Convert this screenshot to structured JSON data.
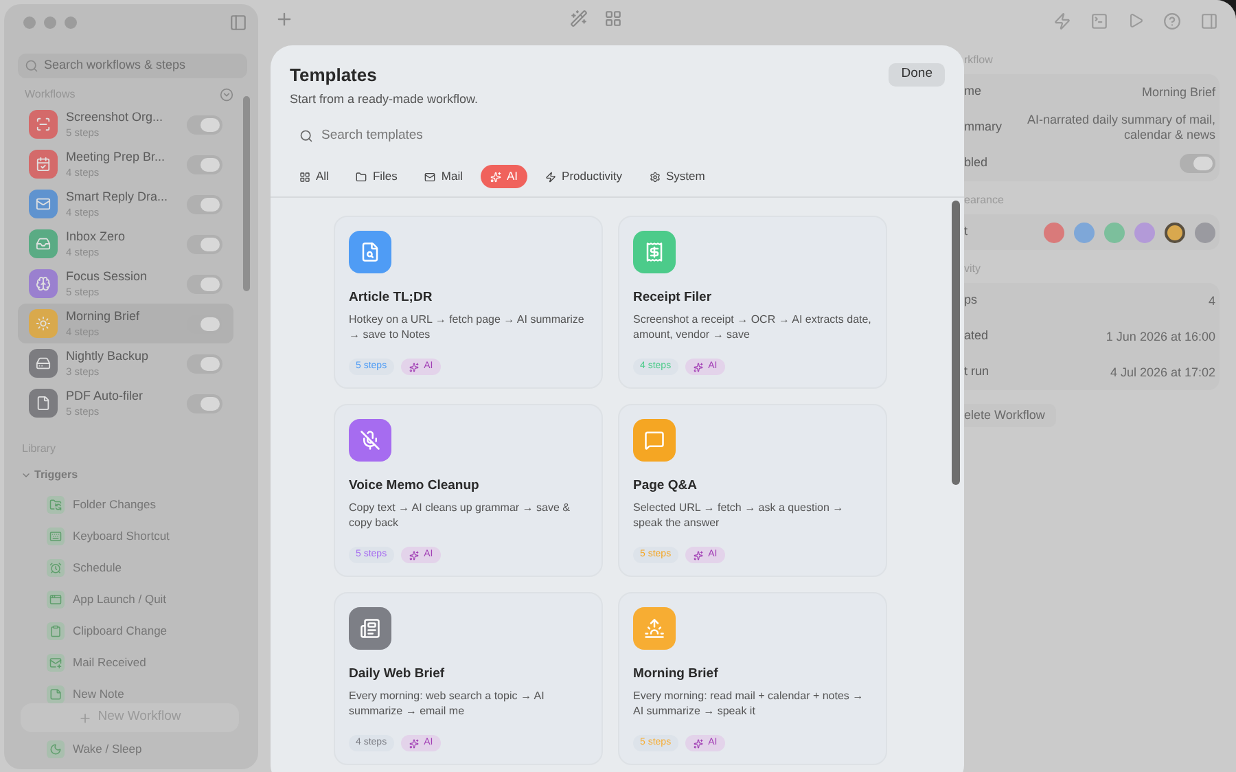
{
  "sidebar": {
    "search": {
      "placeholder": "Search workflows & steps"
    },
    "workflows_label": "Workflows",
    "workflows": [
      {
        "name": "Screenshot Org...",
        "steps": "5 steps",
        "color": "#d46a6a",
        "selected": false,
        "on": true
      },
      {
        "name": "Meeting Prep Br...",
        "steps": "4 steps",
        "color": "#d46a6a",
        "selected": false,
        "on": true
      },
      {
        "name": "Smart Reply Dra...",
        "steps": "4 steps",
        "color": "#5f93cf",
        "selected": false,
        "on": true
      },
      {
        "name": "Inbox Zero",
        "steps": "4 steps",
        "color": "#5aab84",
        "selected": false,
        "on": true
      },
      {
        "name": "Focus Session",
        "steps": "5 steps",
        "color": "#9a80cf",
        "selected": false,
        "on": true
      },
      {
        "name": "Morning Brief",
        "steps": "4 steps",
        "color": "#d9a94c",
        "selected": true,
        "on": true
      },
      {
        "name": "Nightly Backup",
        "steps": "3 steps",
        "color": "#7c7c80",
        "selected": false,
        "on": true
      },
      {
        "name": "PDF Auto-filer",
        "steps": "5 steps",
        "color": "#7c7c80",
        "selected": false,
        "on": true
      }
    ],
    "library_label": "Library",
    "triggers": {
      "label": "Triggers",
      "expanded": true,
      "items": [
        {
          "label": "Folder Changes"
        },
        {
          "label": "Keyboard Shortcut"
        },
        {
          "label": "Schedule"
        },
        {
          "label": "App Launch / Quit"
        },
        {
          "label": "Clipboard Change"
        },
        {
          "label": "Mail Received"
        },
        {
          "label": "New Note"
        },
        {
          "label": "Wake / Sleep"
        }
      ]
    },
    "new_workflow_button": "New Workflow"
  },
  "inspector": {
    "sections": [
      {
        "label": "rkflow",
        "rows": [
          {
            "kind": "text",
            "label": "me",
            "value": "Morning Brief"
          },
          {
            "kind": "text",
            "label": "mmary",
            "value": "AI-narrated daily summary of mail, calendar & news"
          },
          {
            "kind": "toggle",
            "label": "bled",
            "on": true
          }
        ]
      },
      {
        "label": "earance",
        "rows": [
          {
            "kind": "colors",
            "label": "t",
            "colors": [
              {
                "color": "#d97a7a",
                "selected": false
              },
              {
                "color": "#7ea7d8",
                "selected": false
              },
              {
                "color": "#7cbf9c",
                "selected": false
              },
              {
                "color": "#b39ad8",
                "selected": false
              },
              {
                "color": "#d9a84e",
                "selected": true
              },
              {
                "color": "#9a9aa0",
                "selected": false
              }
            ]
          }
        ]
      },
      {
        "label": "vity",
        "rows": [
          {
            "kind": "text",
            "label": "ps",
            "value": "4"
          },
          {
            "kind": "text",
            "label": "ated",
            "value": "1 Jun 2026 at 16:00"
          },
          {
            "kind": "text",
            "label": "t run",
            "value": "4 Jul 2026 at 17:02"
          }
        ]
      }
    ],
    "delete_button": "elete Workflow"
  },
  "modal": {
    "title": "Templates",
    "subtitle": "Start from a ready-made workflow.",
    "done_button": "Done",
    "search": {
      "placeholder": "Search templates"
    },
    "tabs": [
      {
        "label": "All",
        "selected": false
      },
      {
        "label": "Files",
        "selected": false
      },
      {
        "label": "Mail",
        "selected": false
      },
      {
        "label": "AI",
        "selected": true
      },
      {
        "label": "Productivity",
        "selected": false
      },
      {
        "label": "System",
        "selected": false
      }
    ],
    "templates": [
      {
        "title": "Article TL;DR",
        "description": "Hotkey on a URL → fetch page → AI summarize → save to Notes",
        "steps": "5 steps",
        "color": "#4f9cf5",
        "tag": "AI"
      },
      {
        "title": "Receipt Filer",
        "description": "Screenshot a receipt → OCR → AI extracts date, amount, vendor → save",
        "steps": "4 steps",
        "color": "#4ccb8a",
        "tag": "AI"
      },
      {
        "title": "Voice Memo Cleanup",
        "description": "Copy text → AI cleans up grammar → save & copy back",
        "steps": "5 steps",
        "color": "#a66cf0",
        "tag": "AI"
      },
      {
        "title": "Page Q&A",
        "description": "Selected URL → fetch → ask a question → speak the answer",
        "steps": "5 steps",
        "color": "#f5a623",
        "tag": "AI"
      },
      {
        "title": "Daily Web Brief",
        "description": "Every morning: web search a topic → AI summarize → email me",
        "steps": "4 steps",
        "color": "#7d7f86",
        "tag": "AI"
      },
      {
        "title": "Morning Brief",
        "description": "Every morning: read mail + calendar + notes → AI summarize → speak it",
        "steps": "5 steps",
        "color": "#f7ad33",
        "tag": "AI"
      }
    ]
  }
}
